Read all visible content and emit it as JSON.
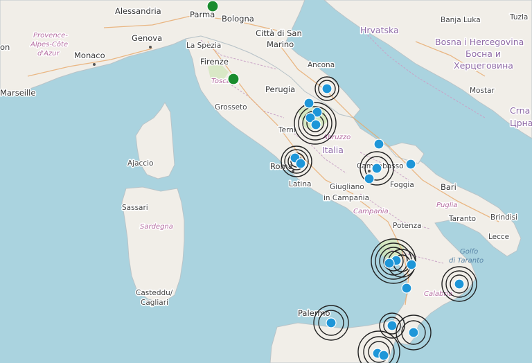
{
  "map": {
    "labels": {
      "alessandria": "Alessandria",
      "parma": "Parma",
      "bologna": "Bologna",
      "genova": "Genova",
      "citta_san_marino_1": "Città di San",
      "citta_san_marino_2": "Marino",
      "monaco": "Monaco",
      "la_spezia": "La Spezia",
      "firenze": "Firenze",
      "provence_1": "Provence-",
      "provence_2": "Alpes-Côte",
      "provence_3": "d'Azur",
      "marseille": "Marseille",
      "ancona": "Ancona",
      "perugia": "Perugia",
      "toscana": "Toscana",
      "grosseto": "Grosseto",
      "terni": "Terni",
      "abruzzo": "Abruzzo",
      "italia": "Italia",
      "ajaccio": "Ajaccio",
      "roma": "Roma",
      "latina": "Latina",
      "campobasso": "Campobasso",
      "foggia": "Foggia",
      "bari": "Bari",
      "giugliano_1": "Giugliano",
      "giugliano_2": "in Campania",
      "campania": "Campania",
      "puglia": "Puglia",
      "brindisi": "Brindisi",
      "taranto": "Taranto",
      "potenza": "Potenza",
      "lecce": "Lecce",
      "golfo_1": "Golfo",
      "golfo_2": "di Taranto",
      "sassari": "Sassari",
      "sardegna": "Sardegna",
      "cagliari_1": "Casteddu/",
      "cagliari_2": "Cagliari",
      "calabria": "Calabria",
      "palermo": "Palermo",
      "hrvatska": "Hrvatska",
      "banja_luka": "Banja Luka",
      "tuzla": "Tuzla",
      "bosna_1": "Bosna i Hercegovina",
      "bosna_2": "Босна и",
      "bosna_3": "Херцеговина",
      "mostar": "Mostar",
      "crna_1": "Crna",
      "crna_2": "Црна",
      "partial_left": "on"
    },
    "marker_colors": {
      "quake": "#1e96d8",
      "green": "#1a8c2e",
      "ring": "#222222"
    }
  }
}
